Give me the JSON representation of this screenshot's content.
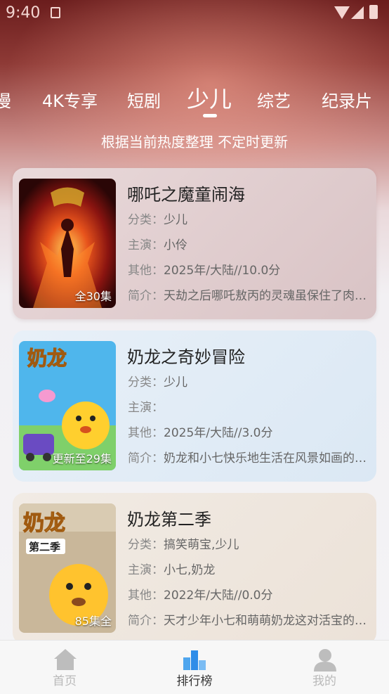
{
  "status_bar": {
    "time": "9:40"
  },
  "tabs": [
    {
      "label": "漫"
    },
    {
      "label": "4K专享"
    },
    {
      "label": "短剧"
    },
    {
      "label": "少儿"
    },
    {
      "label": "综艺"
    },
    {
      "label": "纪录片"
    }
  ],
  "active_tab": "少儿",
  "subtitle": "根据当前热度整理 不定时更新",
  "labels": {
    "category": "分类：",
    "cast": "主演：",
    "other": "其他：",
    "intro": "简介："
  },
  "items": [
    {
      "title": "哪吒之魔童闹海",
      "badge": "全30集",
      "category": "少儿",
      "cast": "小伶",
      "other": "2025年/大陆//10.0分",
      "intro": "天劫之后哪吒敖丙的灵魂虽保住了肉身却很快会魂飞魄散"
    },
    {
      "title": "奶龙之奇妙冒险",
      "badge": "更新至29集",
      "category": "少儿",
      "cast": "",
      "other": "2025年/大陆//3.0分",
      "intro": "奶龙和小七快乐地生活在风景如画的小镇里"
    },
    {
      "title": "奶龙第二季",
      "badge": "85集全",
      "category": "搞笑萌宝,少儿",
      "cast": "小七,奶龙",
      "other": "2022年/大陆//0.0分",
      "intro": "天才少年小七和萌萌奶龙这对活宝的欢乐日常"
    }
  ],
  "nav": [
    {
      "label": "首页",
      "icon": "home-icon"
    },
    {
      "label": "排行榜",
      "icon": "ranking-icon"
    },
    {
      "label": "我的",
      "icon": "profile-icon"
    }
  ],
  "colors": {
    "accent": "#2f8de8",
    "card1_bg": "#e8d6d8",
    "card2_bg": "#e1ecf6",
    "card3_bg": "#efe7df"
  }
}
